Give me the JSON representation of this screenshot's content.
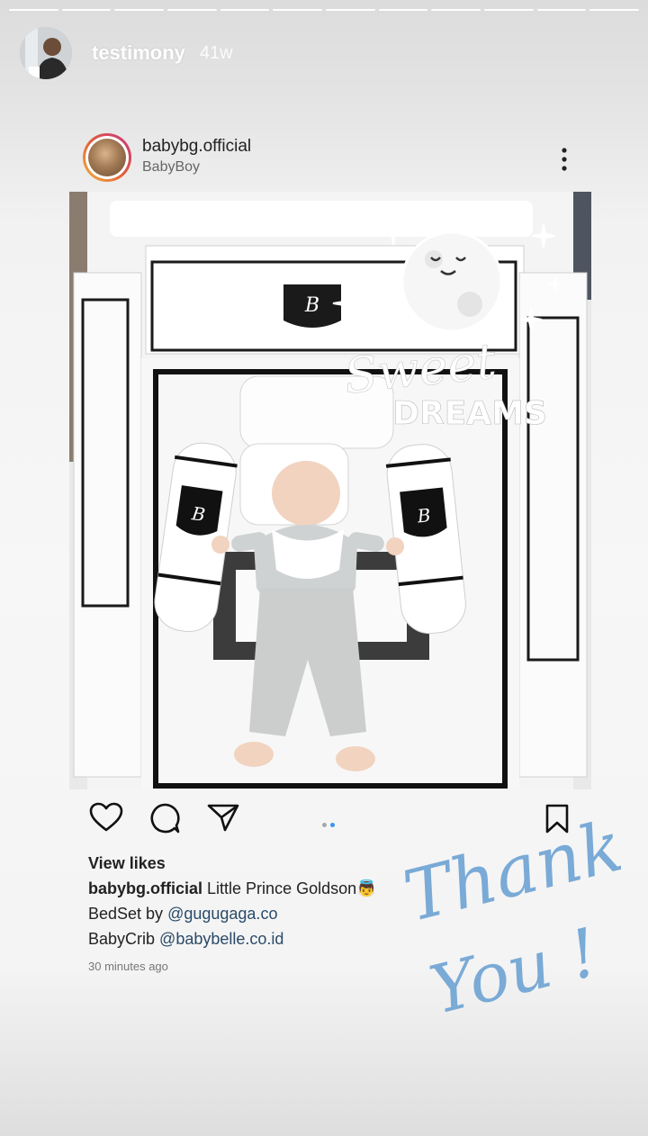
{
  "story": {
    "progress_segments": 12,
    "username": "testimony",
    "time": "41w"
  },
  "post": {
    "username": "babybg.official",
    "subtitle": "BabyBoy",
    "view_likes": "View likes",
    "caption": {
      "username": "babybg.official",
      "line1": "Little Prince Goldson",
      "line1_emoji": "👼",
      "line2_prefix": "BedSet by",
      "line2_link": "@gugugaga.co",
      "line3_prefix": "BabyCrib",
      "line3_link": "@babybelle.co.id"
    },
    "timestamp": "30 minutes ago",
    "carousel": {
      "count": 2,
      "active": 2
    }
  },
  "stickers": {
    "sweet": "Sweet",
    "dreams": "DREAMS",
    "thank": "Thank",
    "you": "You !"
  },
  "colors": {
    "accent_blue": "#3897f0",
    "sticker_blue": "#7aaad6",
    "link": "#2a4a68"
  }
}
